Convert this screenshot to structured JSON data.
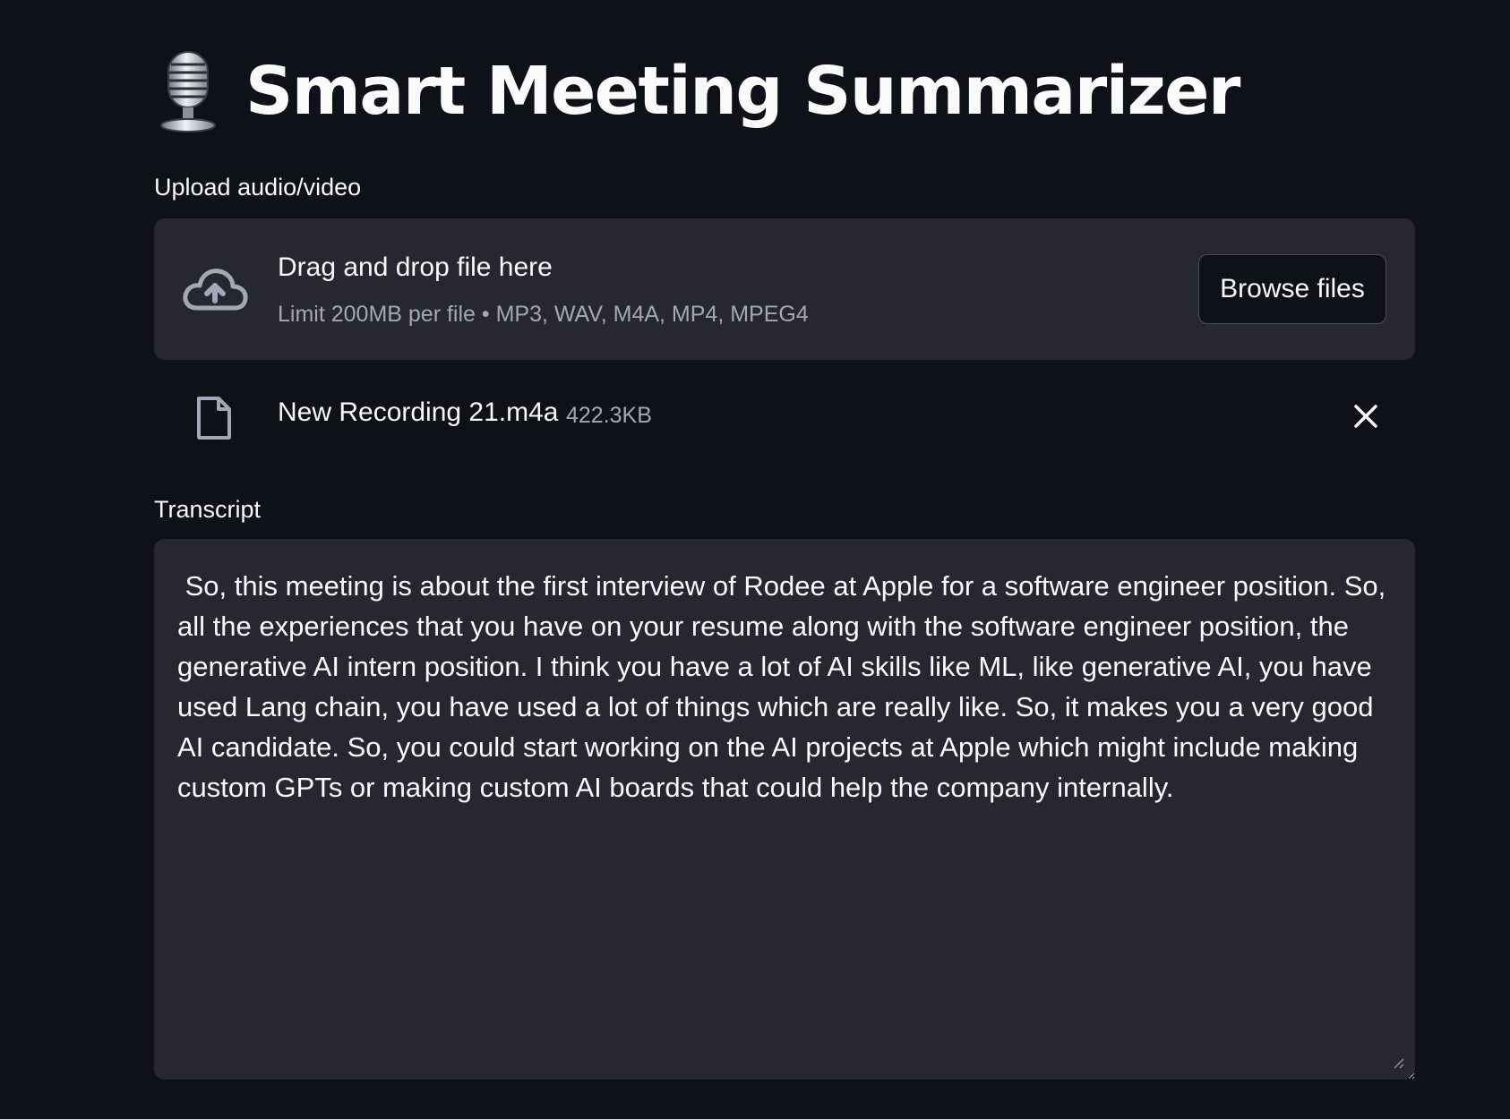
{
  "header": {
    "title": "Smart Meeting Summarizer",
    "icon": "microphone-icon"
  },
  "uploader": {
    "label": "Upload audio/video",
    "drop_title": "Drag and drop file here",
    "limit_text": "Limit 200MB per file • MP3, WAV, M4A, MP4, MPEG4",
    "browse_label": "Browse files",
    "icon": "cloud-upload-icon"
  },
  "uploaded_file": {
    "name": "New Recording 21.m4a",
    "size": "422.3KB",
    "icon": "file-icon",
    "remove_icon": "close-icon"
  },
  "transcript": {
    "label": "Transcript",
    "value": " So, this meeting is about the first interview of Rodee at Apple for a software engineer position. So, all the experiences that you have on your resume along with the software engineer position, the generative AI intern position. I think you have a lot of AI skills like ML, like generative AI, you have used Lang chain, you have used a lot of things which are really like. So, it makes you a very good AI candidate. So, you could start working on the AI projects at Apple which might include making custom GPTs or making custom AI boards that could help the company internally."
  },
  "colors": {
    "background": "#0e1117",
    "panel": "#262730",
    "text": "#fafafa",
    "muted": "#a3a8b8"
  }
}
